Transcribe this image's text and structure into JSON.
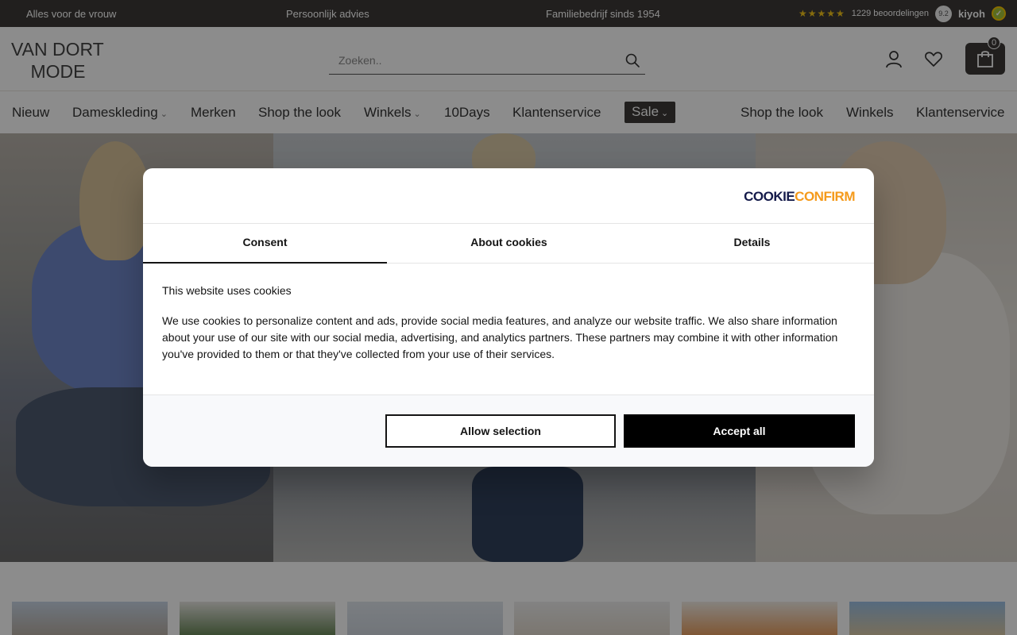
{
  "topbar": {
    "usps": [
      "Alles voor de vrouw",
      "Persoonlijk advies",
      "Familiebedrijf sinds 1954"
    ],
    "stars": "★★★★★",
    "reviews": "1229 beoordelingen",
    "score": "9.2",
    "kiyoh": "kiyoh"
  },
  "header": {
    "logo_line1": "VAN DORT",
    "logo_line2": "MODE",
    "search_placeholder": "Zoeken..",
    "cart_count": "0"
  },
  "nav": {
    "items": [
      {
        "label": "Nieuw"
      },
      {
        "label": "Dameskleding"
      },
      {
        "label": "Merken"
      },
      {
        "label": "Shop the look"
      },
      {
        "label": "Winkels"
      },
      {
        "label": "10Days"
      },
      {
        "label": "Klantenservice"
      },
      {
        "label": "Sale"
      },
      {
        "label": "Shop the look"
      },
      {
        "label": "Winkels"
      },
      {
        "label": "Klantenservice"
      }
    ],
    "caret": "⌄"
  },
  "cookie": {
    "brand_part1": "COOKIE",
    "brand_part2": "CONFIRM",
    "tabs": [
      {
        "label": "Consent"
      },
      {
        "label": "About cookies"
      },
      {
        "label": "Details"
      }
    ],
    "title": "This website uses cookies",
    "text": "We use cookies to personalize content and ads, provide social media features, and analyze our website traffic. We also share information about your use of our site with our social media, advertising, and analytics partners. These partners may combine it with other information you've provided to them or that they've collected from your use of their services.",
    "allow_label": "Allow selection",
    "accept_label": "Accept all"
  },
  "colors": {
    "topbar": "#3d3a37",
    "accent_orange": "#f59a1b",
    "brand_navy": "#141a4a"
  }
}
